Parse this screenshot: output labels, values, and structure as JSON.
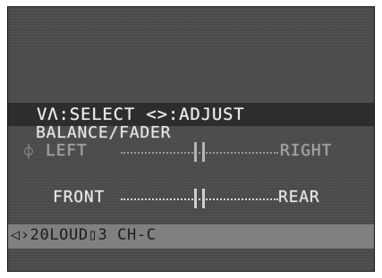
{
  "osd": {
    "header": "VΛ:SELECT  <>:ADJUST",
    "menu_title": "BALANCE/FADER",
    "rows": [
      {
        "cursor_icon": "⌽",
        "left_label": "LEFT",
        "right_label": "RIGHT",
        "level": 0.5
      },
      {
        "cursor_icon": "",
        "left_label": "FRONT",
        "right_label": "REAR",
        "level": 0.5
      }
    ],
    "status": "◁›20LOUD▯3 CH-C"
  },
  "colors": {
    "screen_bg": "#4b4b4b",
    "header_bar": "#2d2d2d",
    "status_bar": "#808080",
    "text_active": "#e8e8e8",
    "text_dim": "#a0a0a0"
  },
  "icons": {
    "cursor": "selection-cursor-icon",
    "slider_thumb": "slider-thumb-icon"
  }
}
